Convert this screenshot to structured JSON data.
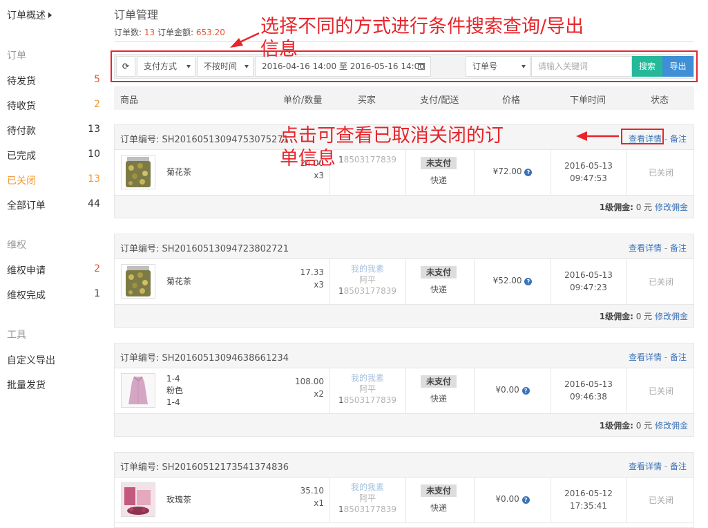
{
  "sidebar": {
    "overview": "订单概述",
    "groups": [
      "订单",
      "维权",
      "工具"
    ],
    "order_items": [
      {
        "label": "待发货",
        "count": "5"
      },
      {
        "label": "待收货",
        "count": "2"
      },
      {
        "label": "待付款",
        "count": "13"
      },
      {
        "label": "已完成",
        "count": "10"
      },
      {
        "label": "已关闭",
        "count": "13"
      },
      {
        "label": "全部订单",
        "count": "44"
      }
    ],
    "rights_items": [
      {
        "label": "维权申请",
        "count": "2"
      },
      {
        "label": "维权完成",
        "count": "1"
      }
    ],
    "tool_items": [
      {
        "label": "自定义导出"
      },
      {
        "label": "批量发货"
      }
    ]
  },
  "header": {
    "title": "订单管理",
    "count_label": "订单数:",
    "count": "13",
    "amount_label": "订单金额:",
    "amount": "653.20"
  },
  "toolbar": {
    "refresh_icon": "refresh-icon",
    "pay_method": "支付方式",
    "time_filter": "不按时间",
    "date_range": "2016-04-16 14:00 至 2016-05-16 14:00",
    "field": "订单号",
    "keyword_placeholder": "请输入关键词",
    "search": "搜索",
    "export": "导出"
  },
  "columns": [
    "商品",
    "单价/数量",
    "买家",
    "支付/配送",
    "价格",
    "下单时间",
    "状态"
  ],
  "orders": [
    {
      "order_no": "订单编号: SH20160513094753075271",
      "view": "查看详情",
      "sep": "-",
      "note": "备注",
      "product": "菊花茶",
      "price": "24.00",
      "qty": "x3",
      "buyer_name": "",
      "buyer_real": "",
      "buyer_phone": "18503177839",
      "pay_status": "未支付",
      "delivery": "快递",
      "amount": "¥72.00",
      "date": "2016-05-13",
      "time": "09:47:53",
      "status": "已关闭",
      "comm_label": "1级佣金:",
      "comm_value": "0 元",
      "comm_link": "修改佣金"
    },
    {
      "order_no": "订单编号: SH20160513094723802721",
      "view": "查看详情",
      "sep": "-",
      "note": "备注",
      "product": "菊花茶",
      "price": "17.33",
      "qty": "x3",
      "buyer_name": "我的我素",
      "buyer_real": "阿平",
      "buyer_phone": "18503177839",
      "pay_status": "未支付",
      "delivery": "快递",
      "amount": "¥52.00",
      "date": "2016-05-13",
      "time": "09:47:23",
      "status": "已关闭",
      "comm_label": "1级佣金:",
      "comm_value": "0 元",
      "comm_link": "修改佣金"
    },
    {
      "order_no": "订单编号: SH20160513094638661234",
      "view": "查看详情",
      "sep": "-",
      "note": "备注",
      "product": "1-4",
      "product2": "粉色",
      "product3": "1-4",
      "price": "108.00",
      "qty": "x2",
      "buyer_name": "我的我素",
      "buyer_real": "阿平",
      "buyer_phone": "18503177839",
      "pay_status": "未支付",
      "delivery": "快递",
      "amount": "¥0.00",
      "date": "2016-05-13",
      "time": "09:46:38",
      "status": "已关闭",
      "comm_label": "1级佣金:",
      "comm_value": "0 元",
      "comm_link": "修改佣金"
    },
    {
      "order_no": "订单编号: SH20160512173541374836",
      "view": "查看详情",
      "sep": "-",
      "note": "备注",
      "product": "玫瑰茶",
      "price": "35.10",
      "qty": "x1",
      "buyer_name": "我的我素",
      "buyer_real": "阿平",
      "buyer_phone": "18503177839",
      "pay_status": "未支付",
      "delivery": "快递",
      "amount": "¥0.00",
      "date": "2016-05-12",
      "time": "17:35:41",
      "status": "已关闭"
    }
  ],
  "annotations": {
    "search_tip_line1": "选择不同的方式进行条件搜索查询/导出",
    "search_tip_line2": "信息",
    "detail_tip_line1": "点击可查看已取消关闭的订",
    "detail_tip_line2": "单信息",
    "color": "#e8242b"
  }
}
